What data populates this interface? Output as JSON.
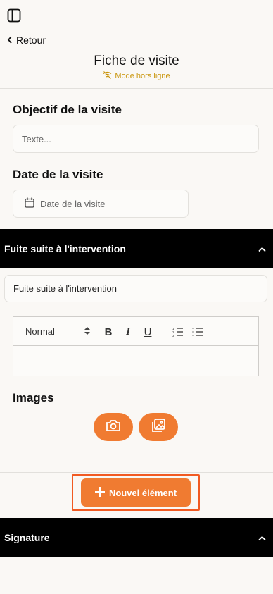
{
  "header": {
    "back_label": "Retour",
    "title": "Fiche de visite",
    "offline_label": "Mode hors ligne"
  },
  "form": {
    "objective_label": "Objectif de la visite",
    "objective_placeholder": "Texte...",
    "date_label": "Date de la visite",
    "date_placeholder": "Date de la visite"
  },
  "section": {
    "title": "Fuite suite à l'intervention",
    "title_value": "Fuite suite à l'intervention",
    "editor": {
      "format_value": "Normal",
      "bold_label": "B",
      "italic_label": "I",
      "underline_label": "U"
    },
    "images_label": "Images"
  },
  "actions": {
    "new_element_label": "Nouvel élément"
  },
  "signature": {
    "title": "Signature"
  },
  "colors": {
    "accent": "#f07b31",
    "offline": "#c9950c",
    "highlight": "#f15a22"
  }
}
